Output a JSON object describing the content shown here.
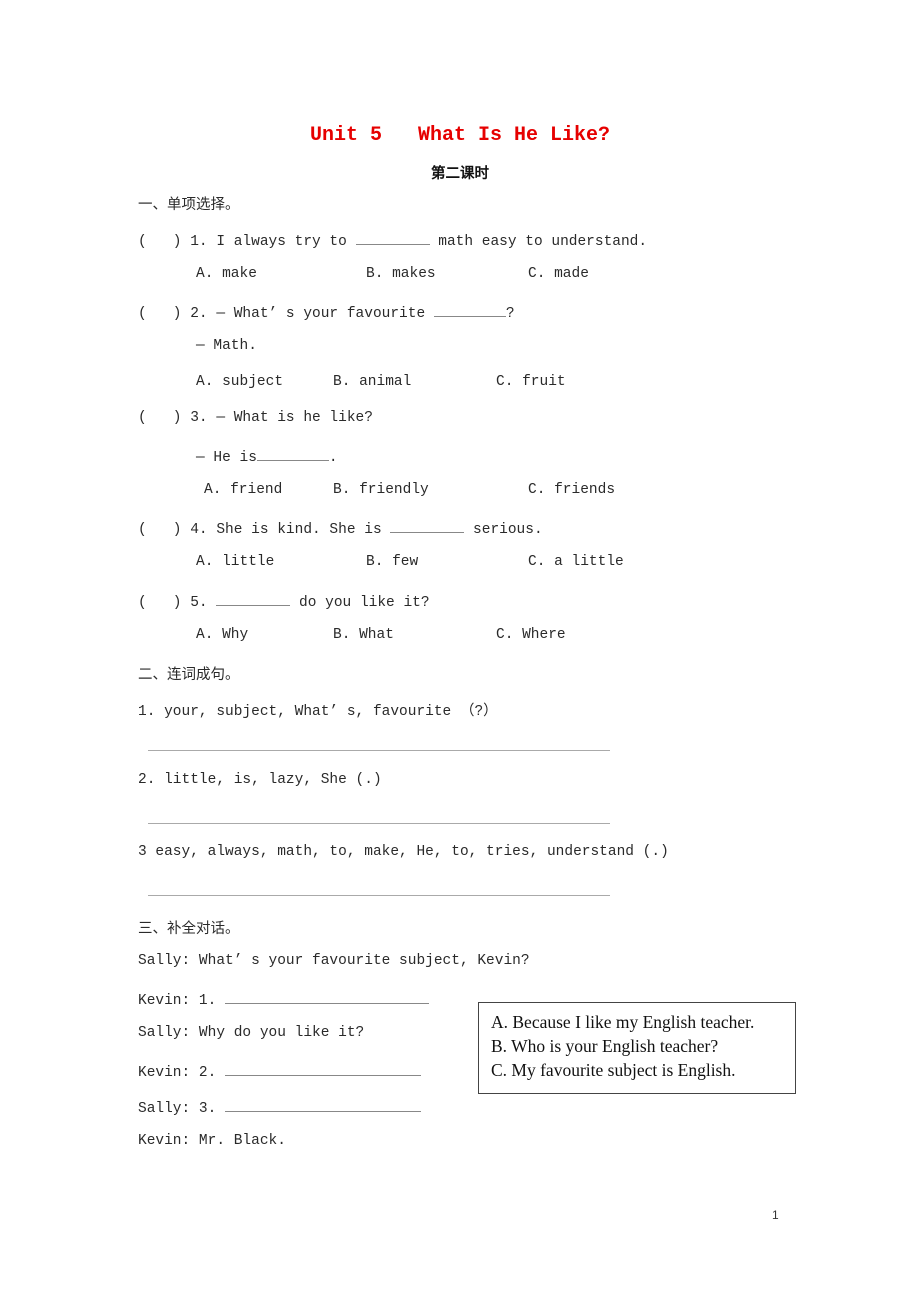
{
  "header": {
    "title": "Unit 5   What Is He Like?",
    "subtitle": "第二课时",
    "title_color": "#e60000"
  },
  "section1": {
    "heading": "一、单项选择。",
    "questions": [
      {
        "prefix": "(   ) 1. I always try to ",
        "suffix": " math easy to understand.",
        "options": [
          "A. make",
          "B. makes",
          "C. made"
        ]
      },
      {
        "prefix": "(   ) 2. — What’ s your favourite ",
        "suffix": "?",
        "response": "— Math.",
        "options": [
          "A. subject",
          "B. animal",
          "C. fruit"
        ]
      },
      {
        "prefix": "(   ) 3. — What is he like?",
        "response_prefix": "— He is",
        "response_suffix": ".",
        "options": [
          "A. friend",
          "B. friendly",
          "C. friends"
        ]
      },
      {
        "prefix": "(   ) 4. She is kind. She is ",
        "suffix": " serious.",
        "options": [
          "A. little",
          "B. few",
          "C. a little"
        ]
      },
      {
        "prefix": "(   ) 5. ",
        "suffix": " do you like it?",
        "options": [
          "A. Why",
          "B. What",
          "C. Where"
        ]
      }
    ]
  },
  "section2": {
    "heading": "二、连词成句。",
    "items": [
      "1. your, subject, What’ s, favourite （?）",
      "2. little, is, lazy, She (.)",
      "3 easy, always, math, to, make, He, to, tries, understand (.)"
    ]
  },
  "section3": {
    "heading": "三、补全对话。",
    "lines": [
      "Sally: What’ s your favourite subject, Kevin?",
      "Kevin: 1. ",
      "Sally: Why do you like it?",
      "Kevin: 2. ",
      "Sally: 3. ",
      "Kevin: Mr. Black."
    ],
    "choices": [
      "A. Because I like my English teacher.",
      "B. Who is your English teacher?",
      "C. My favourite subject is English."
    ]
  },
  "footer": {
    "page_number": "1"
  }
}
